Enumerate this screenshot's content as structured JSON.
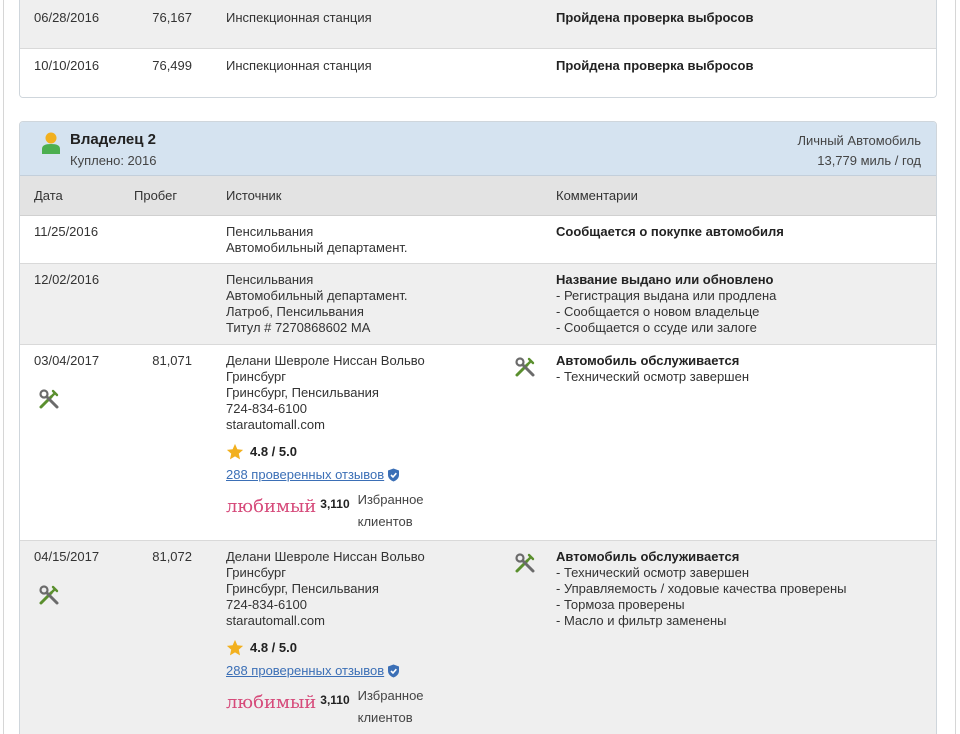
{
  "prev_records": [
    {
      "date": "06/28/2016",
      "odometer": "76,167",
      "source": "Инспекционная станция",
      "comment": "Пройдена проверка выбросов"
    },
    {
      "date": "10/10/2016",
      "odometer": "76,499",
      "source": "Инспекционная станция",
      "comment": "Пройдена проверка выбросов"
    }
  ],
  "owner": {
    "title": "Владелец 2",
    "bought": "Куплено: 2016",
    "type": "Личный Автомобиль",
    "miles": "13,779 миль / год",
    "icon": "person-icon"
  },
  "columns": {
    "date": "Дата",
    "odometer": "Пробег",
    "source": "Источник",
    "comments": "Комментарии"
  },
  "records": [
    {
      "date": "11/25/2016",
      "odometer": "",
      "source": [
        "Пенсильвания",
        "Автомобильный департамент."
      ],
      "comment_title": "Сообщается о покупке автомобиля",
      "comment_items": []
    },
    {
      "date": "12/02/2016",
      "odometer": "",
      "source": [
        "Пенсильвания",
        "Автомобильный департамент.",
        "Латроб, Пенсильвания",
        "Титул # 7270868602 MA"
      ],
      "comment_title": "Название выдано или обновлено",
      "comment_items": [
        "- Регистрация выдана или продлена",
        "- Сообщается о новом владельце",
        "- Сообщается о ссуде или залоге"
      ]
    },
    {
      "date": "03/04/2017",
      "odometer": "81,071",
      "source": [
        "Делани Шевроле Ниссан Вольво",
        "Гринсбург",
        "Гринсбург, Пенсильвания",
        "724-834-6100",
        "starautomall.com"
      ],
      "rating": "4.8 / 5.0",
      "reviews": "288 проверенных отзывов",
      "fav_logo": "любимый",
      "fav_count": "3,110",
      "fav_label_1": "Избранное",
      "fav_label_2": "клиентов",
      "comment_title": "Автомобиль обслуживается",
      "comment_items": [
        "- Технический осмотр завершен"
      ]
    },
    {
      "date": "04/15/2017",
      "odometer": "81,072",
      "source": [
        "Делани Шевроле Ниссан Вольво",
        "Гринсбург",
        "Гринсбург, Пенсильвания",
        "724-834-6100",
        "starautomall.com"
      ],
      "rating": "4.8 / 5.0",
      "reviews": "288 проверенных отзывов",
      "fav_logo": "любимый",
      "fav_count": "3,110",
      "fav_label_1": "Избранное",
      "fav_label_2": "клиентов",
      "comment_title": "Автомобиль обслуживается",
      "comment_items": [
        "- Технический осмотр завершен",
        "- Управляемость / ходовые качества проверены",
        "- Тормоза проверены",
        "- Масло и фильтр заменены"
      ]
    }
  ],
  "colors": {
    "header_bg": "#d5e3f0",
    "gray_row": "#efefef",
    "link": "#3b6fb6",
    "star": "#f2b01e",
    "fav_logo": "#d64a7a"
  }
}
